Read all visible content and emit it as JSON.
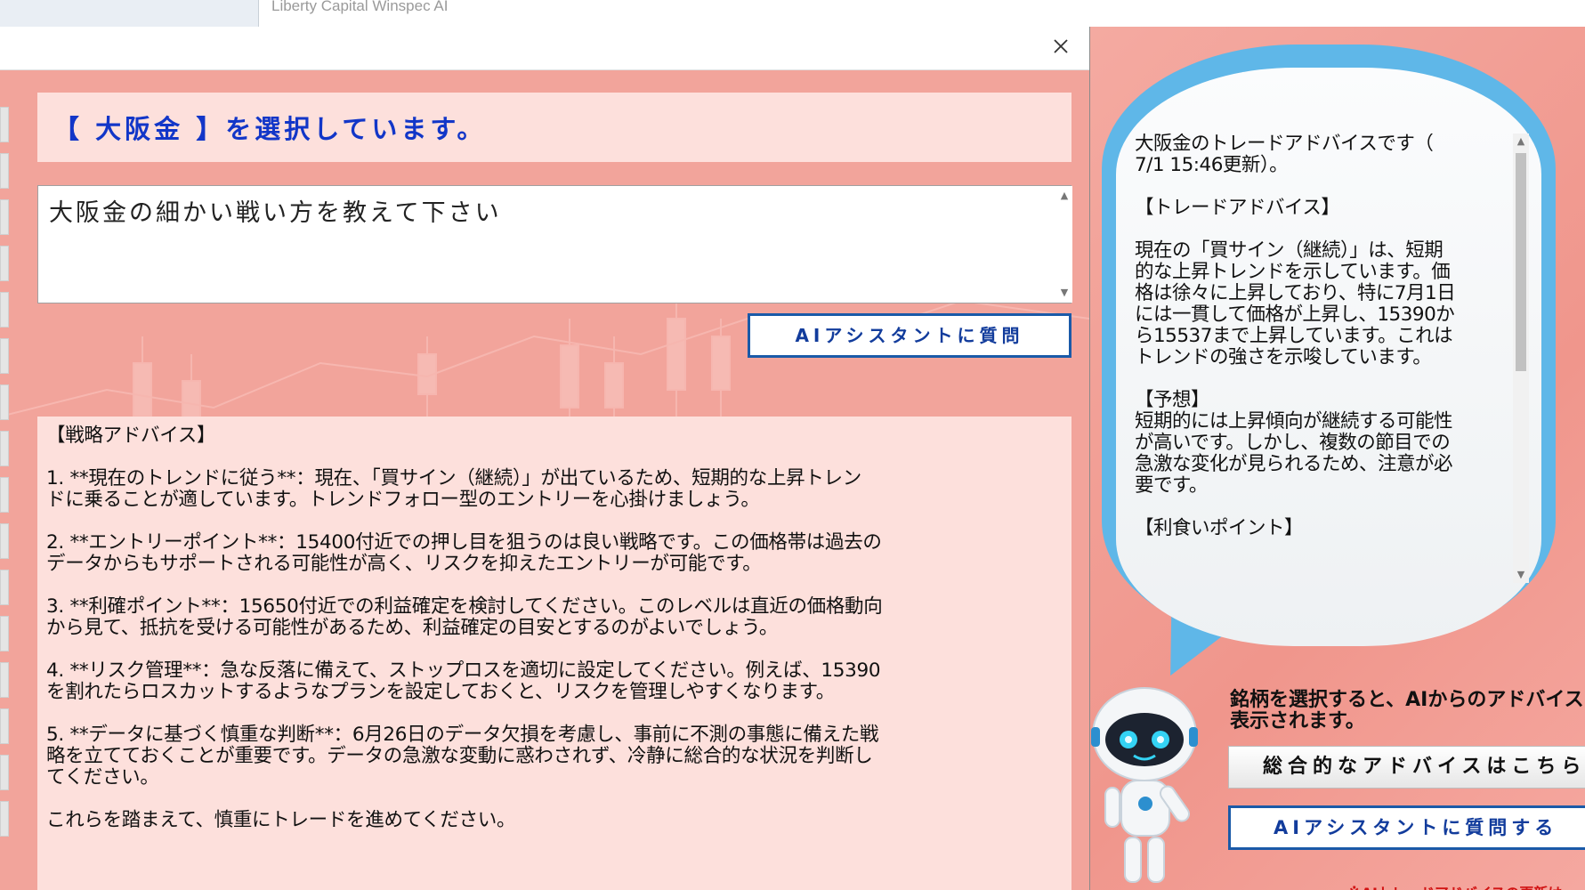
{
  "app": {
    "title": "Liberty Capital Winspec AI"
  },
  "dialog": {
    "selection_text": "【 大阪金 】を選択しています。",
    "question_text": "大阪金の細かい戦い方を教えて下さい",
    "ask_button_label": "AIアシスタントに質問",
    "strategy_text": "【戦略アドバイス】\n\n1. **現在のトレンドに従う**：現在、「買サイン（継続）」が出ているため、短期的な上昇トレン\nドに乗ることが適しています。トレンドフォロー型のエントリーを心掛けましょう。\n\n2. **エントリーポイント**：15400付近での押し目を狙うのは良い戦略です。この価格帯は過去の\nデータからもサポートされる可能性が高く、リスクを抑えたエントリーが可能です。\n\n3. **利確ポイント**：15650付近での利益確定を検討してください。このレベルは直近の価格動向\nから見て、抵抗を受ける可能性があるため、利益確定の目安とするのがよいでしょう。\n\n4. **リスク管理**：急な反落に備えて、ストップロスを適切に設定してください。例えば、15390\nを割れたらロスカットするようなプランを設定しておくと、リスクを管理しやすくなります。\n\n5. **データに基づく慎重な判断**：6月26日のデータ欠損を考慮し、事前に不測の事態に備えた戦\n略を立てておくことが重要です。データの急激な変動に惑わされず、冷静に総合的な状況を判断し\nてください。\n\nこれらを踏まえて、慎重にトレードを進めてください。"
  },
  "right_panel": {
    "advice_text": "大阪金のトレードアドバイスです（\n7/1 15:46更新）。\n\n【トレードアドバイス】\n\n現在の「買サイン（継続）」は、短期\n的な上昇トレンドを示しています。価\n格は徐々に上昇しており、特に7月1日\nには一貫して価格が上昇し、15390か\nら15537まで上昇しています。これは\nトレンドの強さを示唆しています。\n\n【予想】\n短期的には上昇傾向が継続する可能性\nが高いです。しかし、複数の節目での\n急激な変化が見られるため、注意が必\n要です。\n\n【利食いポイント】",
    "info_line1": "銘柄を選択すると、AIからのアドバイス",
    "info_line2": "表示されます。",
    "general_button_label": "総合的なアドバイスはこちら",
    "ask_button_label": "AIアシスタントに質問する",
    "footnote": "※AIトレードアドバイスの更新は、"
  },
  "colors": {
    "accent_blue": "#1236c8",
    "button_border": "#1a5aa8",
    "panel_pink": "#fde0dc",
    "background_salmon": "#f2a49b",
    "footnote_red": "#d11313"
  }
}
